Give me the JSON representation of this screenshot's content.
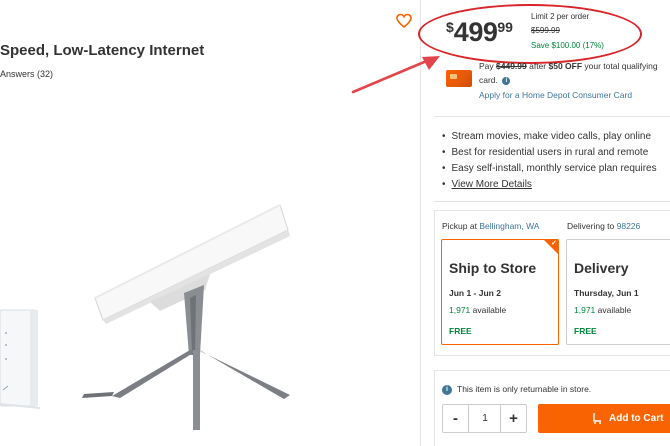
{
  "product": {
    "title_fragment": "Speed, Low-Latency Internet",
    "answers_fragment": "Answers (32)"
  },
  "price": {
    "currency_symbol": "$",
    "whole": "499",
    "cents": "99",
    "limit_text": "Limit 2 per order",
    "was_price": "$599.99",
    "savings": "Save $100.00 (17%)"
  },
  "credit_offer": {
    "pay_prefix": "Pay ",
    "pay_strike": "$449.99",
    "pay_after": " after ",
    "pay_off": "$50 OFF",
    "pay_suffix": " your total qualifying",
    "card_word": "card.",
    "apply_link": "Apply for a Home Depot Consumer Card"
  },
  "bullets": [
    "Stream movies, make video calls, play online",
    "Best for residential users in rural and remote",
    "Easy self-install, monthly service plan requires"
  ],
  "view_more": "View More Details",
  "fulfillment": {
    "pickup_label": "Pickup at ",
    "pickup_store": "Bellingham, WA",
    "delivery_label": "Delivering to ",
    "delivery_zip": "98226",
    "options": [
      {
        "title": "Ship to Store",
        "date": "Jun 1 - Jun 2",
        "available_count": "1,971",
        "available_suffix": " available",
        "price": "FREE",
        "selected": true
      },
      {
        "title": "Delivery",
        "date": "Thursday, Jun 1",
        "available_count": "1,971",
        "available_suffix": " available",
        "price": "FREE",
        "selected": false
      }
    ]
  },
  "cart": {
    "return_notice": "This item is only returnable in store.",
    "quantity": "1",
    "minus_label": "-",
    "plus_label": "+",
    "add_to_cart": "Add to Cart"
  },
  "colors": {
    "brand_orange": "#f96302",
    "link_blue": "#3e7697",
    "success_green": "#00873c",
    "annotation_red": "#d9262b"
  }
}
